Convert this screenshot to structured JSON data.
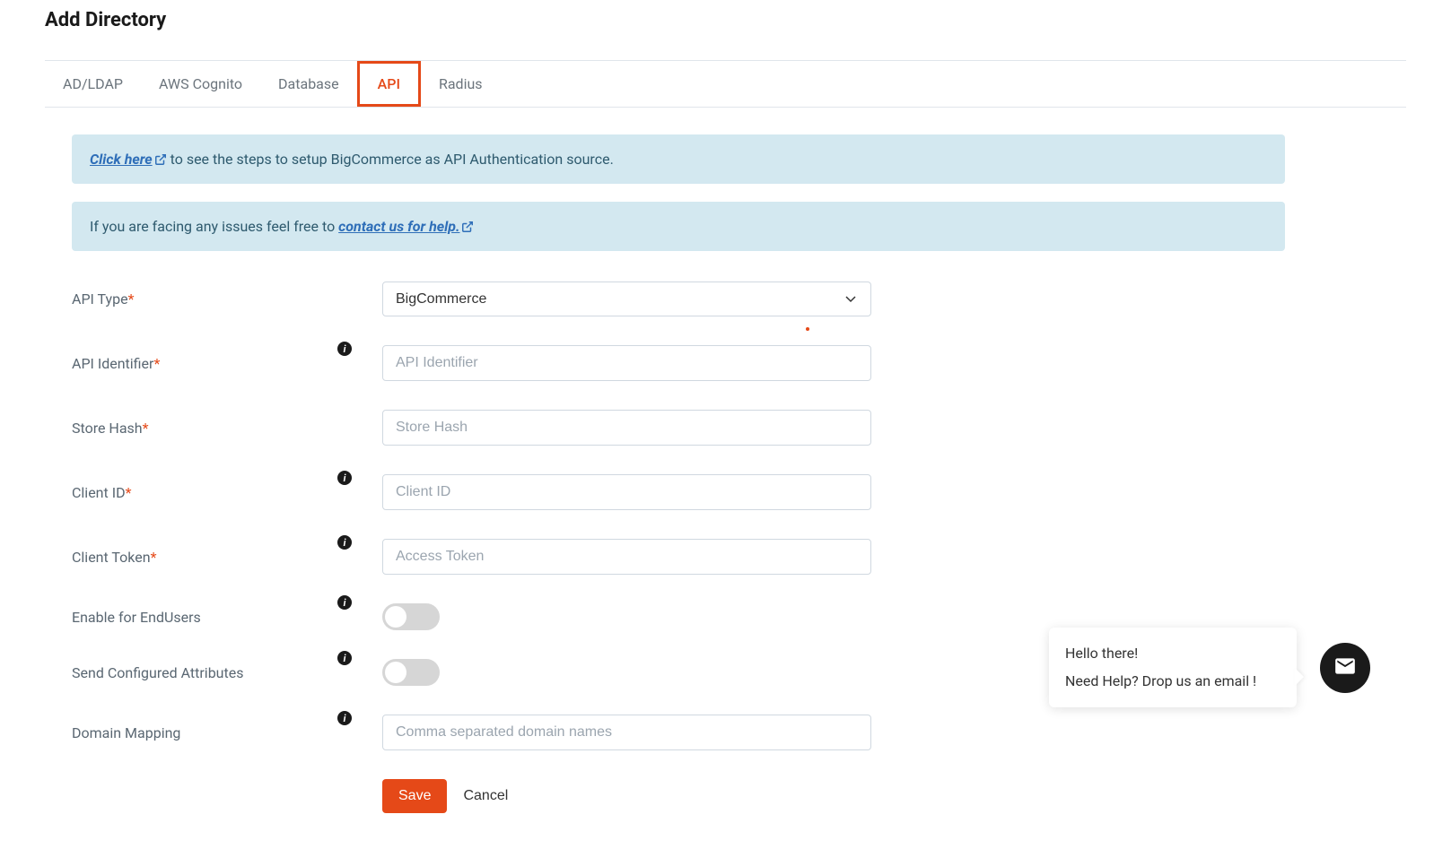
{
  "page": {
    "title": "Add Directory"
  },
  "tabs": {
    "ad_ldap": "AD/LDAP",
    "aws_cognito": "AWS Cognito",
    "database": "Database",
    "api": "API",
    "radius": "Radius"
  },
  "banners": {
    "setup": {
      "link_text": "Click here",
      "text_after": " to see the steps to setup BigCommerce as API Authentication source."
    },
    "help": {
      "text_before": "If you are facing any issues feel free to ",
      "link_text": "contact us for help."
    }
  },
  "form": {
    "api_type": {
      "label": "API Type",
      "value": "BigCommerce",
      "options": [
        "BigCommerce"
      ]
    },
    "api_identifier": {
      "label": "API Identifier",
      "placeholder": "API Identifier"
    },
    "store_hash": {
      "label": "Store Hash",
      "placeholder": "Store Hash"
    },
    "client_id": {
      "label": "Client ID",
      "placeholder": "Client ID"
    },
    "client_token": {
      "label": "Client Token",
      "placeholder": "Access Token"
    },
    "enable_endusers": {
      "label": "Enable for EndUsers"
    },
    "send_attributes": {
      "label": "Send Configured Attributes"
    },
    "domain_mapping": {
      "label": "Domain Mapping",
      "placeholder": "Comma separated domain names"
    }
  },
  "actions": {
    "save": "Save",
    "cancel": "Cancel"
  },
  "chat": {
    "greeting": "Hello there!",
    "prompt": "Need Help? Drop us an email !"
  }
}
